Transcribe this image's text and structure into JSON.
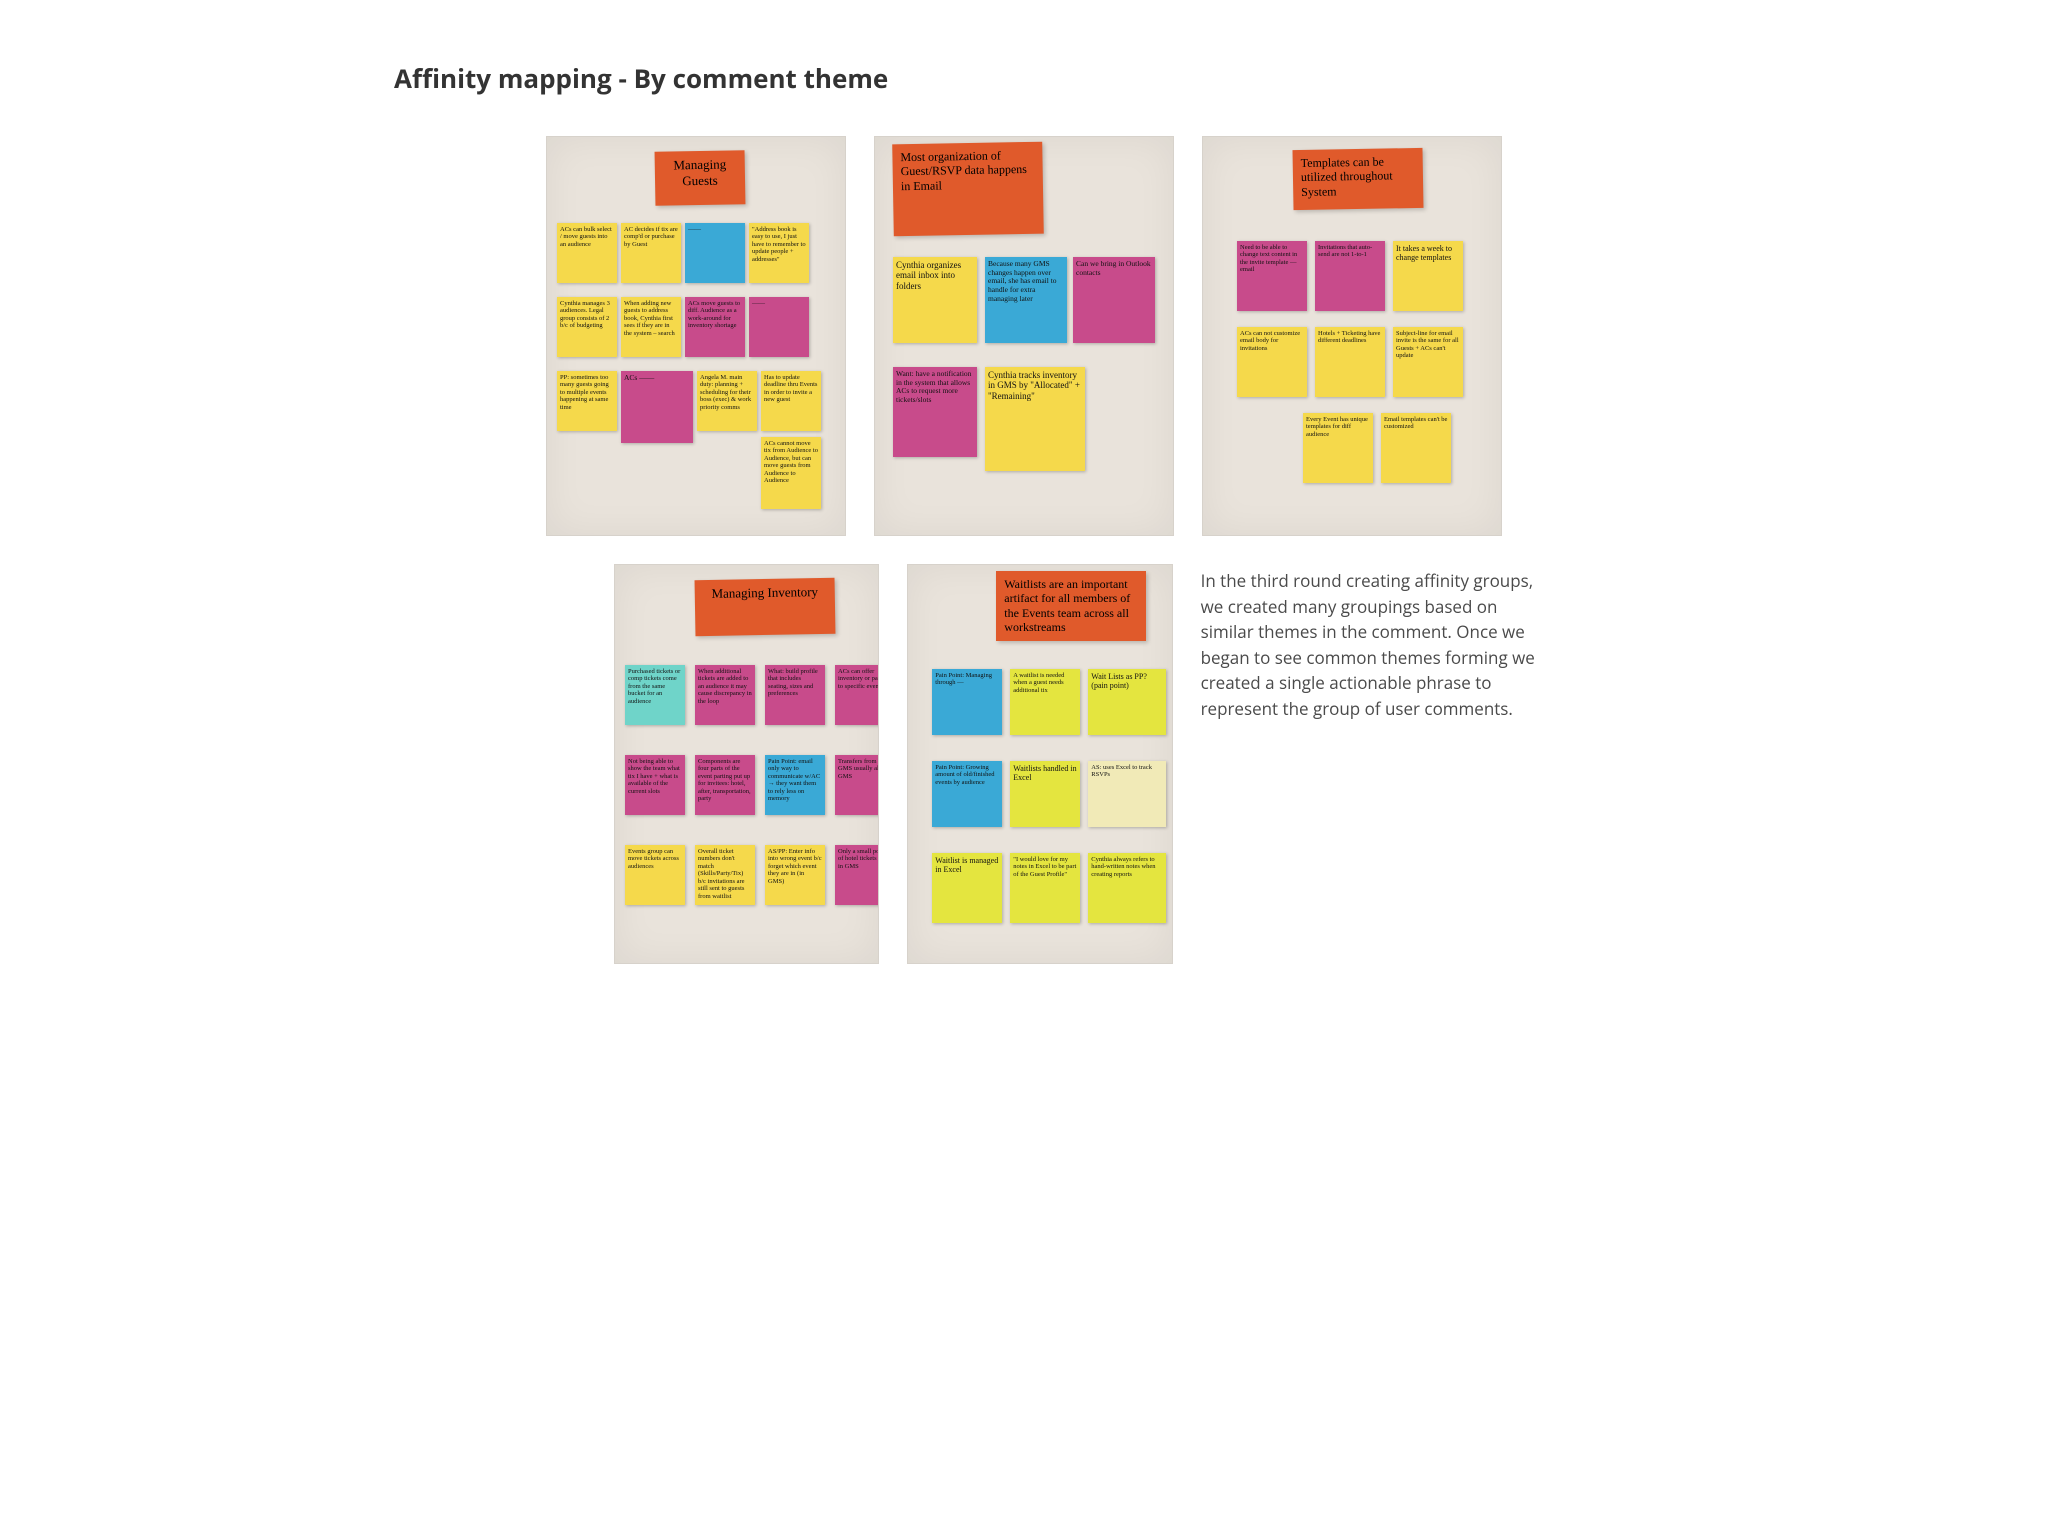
{
  "title": "Affinity mapping - By comment theme",
  "caption": "In the third round creating affinity groups, we created many groupings based on similar themes in the comment. Once we began to see common themes forming we created a single actionable phrase to represent the group of user comments.",
  "boards": {
    "b1": {
      "header": "Managing Guests",
      "notes": {
        "n1": "ACs can bulk select / move guests into an audience",
        "n2": "AC decides if tix are comp'd or purchase by Guest",
        "n3": "——",
        "n4": "\"Address book is easy to use, I just have to remember to update people + addresses\"",
        "n5": "Cynthia manages 3 audiences. Legal group consists of 2 b/c of budgeting",
        "n6": "When adding new guests to address book, Cynthia first sees if they are in the system – search",
        "n7": "ACs move guests to diff. Audience as a work-around for inventory shortage",
        "n8": "——",
        "n9": "PP: sometimes too many guests going to multiple events happening at same time",
        "n10": "ACs ——",
        "n11": "Angela M. main duty: planning + scheduling for their boss (exec) & work priority comms",
        "n12": "Has to update deadline thru Events in order to invite a new guest",
        "n13": "ACs cannot move tix from Audience to Audience, but can move guests from Audience to Audience"
      }
    },
    "b2": {
      "header": "Most organization of Guest/RSVP data happens in Email",
      "notes": {
        "n1": "Cynthia organizes email inbox into folders",
        "n2": "Because many GMS changes happen over email, she has email to handle for extra managing later",
        "n3": "Can we bring in Outlook contacts",
        "n4": "Want: have a notification in the system that allows ACs to request more tickets/slots",
        "n5": "Cynthia tracks inventory in GMS by \"Allocated\" + \"Remaining\""
      }
    },
    "b3": {
      "header": "Templates can be utilized throughout System",
      "notes": {
        "n1": "Need to be able to change text content in the invite template — email",
        "n2": "Invitations that auto-send are not 1-to-1",
        "n3": "It takes a week to change templates",
        "n4": "ACs can not customize email body for invitations",
        "n5": "Hotels + Ticketing have different deadlines",
        "n6": "Subject-line for email invite is the same for all Guests + ACs can't update",
        "n7": "Every Event has unique templates for diff audience",
        "n8": "Email templates can't be customized"
      }
    },
    "b4": {
      "header": "Managing Inventory",
      "notes": {
        "n1": "Purchased tickets or comp tickets come from the same bucket for an audience",
        "n2": "When additional tickets are added to an audience it may cause discrepancy in the loop",
        "n3": "What: build profile that includes seating, sizes and preferences",
        "n4": "ACs can offer inventory or passes to specific events",
        "n5": "Not being able to show the team what tix I have + what is available of the current slots",
        "n6": "Components are four parts of the event parting put up for invitees: hotel, after, transportation, party",
        "n7": "Pain Point: email only way to communicate w/AC → they want them to rely less on memory",
        "n8": "Transfers from GMS usually all in GMS",
        "n9": "Events group can move tickets across audiences",
        "n10": "Overall ticket numbers don't match (Skills/Party/Tix) b/c invitations are still sent to guests from waitlist",
        "n11": "AS/PP: Enter info into wrong event b/c forget which event they are in (in GMS)",
        "n12": "Only a small portion of hotel tickets are in GMS"
      }
    },
    "b5": {
      "header": "Waitlists are an important artifact for all members of the Events team across all workstreams",
      "notes": {
        "n1": "Pain Point: Managing through —",
        "n2": "A waitlist is needed when a guest needs additional tix",
        "n3": "Wait Lists as PP? (pain point)",
        "n4": "Pain Point: Growing amount of old/finished events by audience",
        "n5": "Waitlists handled in Excel",
        "n6": "AS: uses Excel to track RSVPs",
        "n7": "Waitlist is managed in Excel",
        "n8": "\"I would love for my notes in Excel to be part of the Guest Profile\"",
        "n9": "Cynthia always refers to hand-written notes when creating reports"
      }
    }
  }
}
